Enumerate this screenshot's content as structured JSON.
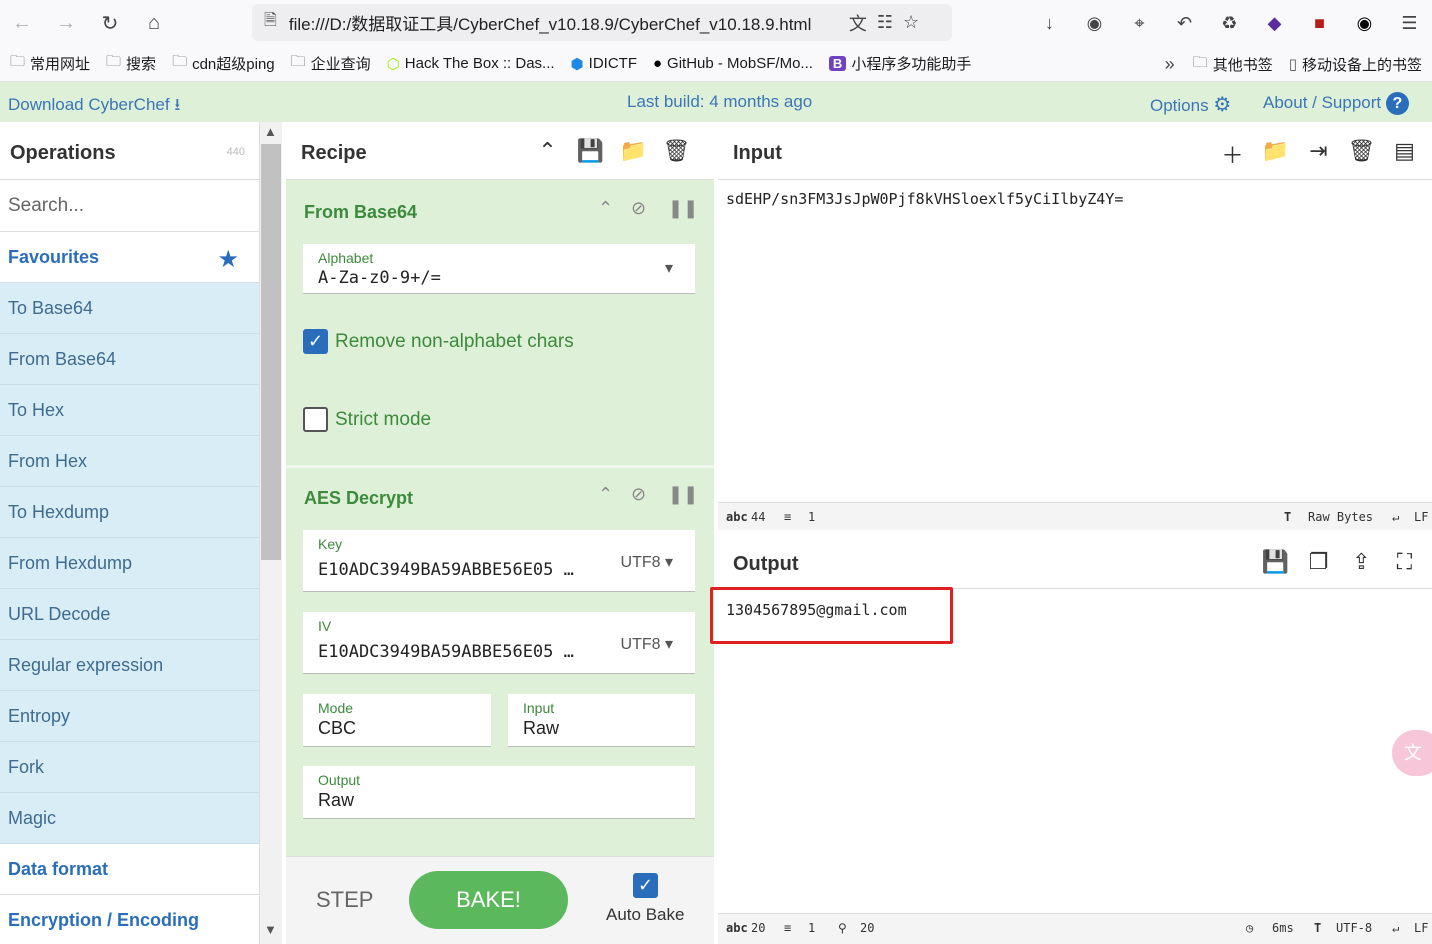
{
  "browser": {
    "url": "file:///D:/数据取证工具/CyberChef_v10.18.9/CyberChef_v10.18.9.html"
  },
  "bookmarks": [
    {
      "label": "常用网址",
      "icon": "folder-icon"
    },
    {
      "label": "搜索",
      "icon": "folder-icon"
    },
    {
      "label": "cdn超级ping",
      "icon": "folder-icon"
    },
    {
      "label": "企业查询",
      "icon": "folder-icon"
    },
    {
      "label": "Hack The Box :: Das...",
      "icon": "htb-icon"
    },
    {
      "label": "IDICTF",
      "icon": "idictf-icon"
    },
    {
      "label": "GitHub - MobSF/Mo...",
      "icon": "github-icon"
    },
    {
      "label": "小程序多功能助手",
      "icon": "b-icon"
    }
  ],
  "bookmarks_right": [
    {
      "label": "其他书签"
    },
    {
      "label": "移动设备上的书签"
    }
  ],
  "banner": {
    "download": "Download CyberChef",
    "last_build": "Last build: 4 months ago",
    "options": "Options",
    "about": "About / Support"
  },
  "operations": {
    "title": "Operations",
    "count": "440",
    "search_placeholder": "Search...",
    "favourites": "Favourites",
    "items": [
      "To Base64",
      "From Base64",
      "To Hex",
      "From Hex",
      "To Hexdump",
      "From Hexdump",
      "URL Decode",
      "Regular expression",
      "Entropy",
      "Fork",
      "Magic"
    ],
    "categories_after": [
      "Data format",
      "Encryption / Encoding"
    ]
  },
  "recipe": {
    "title": "Recipe",
    "from_base64": {
      "title": "From Base64",
      "alphabet_label": "Alphabet",
      "alphabet_value": "A-Za-z0-9+/=",
      "remove_nonalpha": "Remove non-alphabet chars",
      "strict_mode": "Strict mode"
    },
    "aes_decrypt": {
      "title": "AES Decrypt",
      "key_label": "Key",
      "key_value": "E10ADC3949BA59ABBE56E05 …",
      "key_enc": "UTF8",
      "iv_label": "IV",
      "iv_value": "E10ADC3949BA59ABBE56E05 …",
      "iv_enc": "UTF8",
      "mode_label": "Mode",
      "mode_value": "CBC",
      "input_label": "Input",
      "input_value": "Raw",
      "output_label": "Output",
      "output_value": "Raw"
    },
    "step": "STEP",
    "bake": "BAKE!",
    "auto_bake": "Auto Bake"
  },
  "input": {
    "title": "Input",
    "text": "sdEHP/sn3FM3JsJpW0Pjf8kVHSloexlf5yCiIlbyZ4Y=",
    "status_length": "44",
    "status_lines": "1",
    "status_encoding": "Raw Bytes",
    "status_eol": "LF"
  },
  "output": {
    "title": "Output",
    "text": "1304567895@gmail.com",
    "status_length": "20",
    "status_lines": "1",
    "status_pos": "20",
    "status_time": "6ms",
    "status_encoding": "UTF-8",
    "status_eol": "LF"
  },
  "colors": {
    "banner_bg": "#dff0d8",
    "link": "#3a76b8",
    "op_item_bg": "#d9edf7",
    "recipe_bg": "#dff0d8",
    "recipe_title": "#3c8a3c",
    "bake": "#5cb85c",
    "highlight": "#e02020"
  }
}
